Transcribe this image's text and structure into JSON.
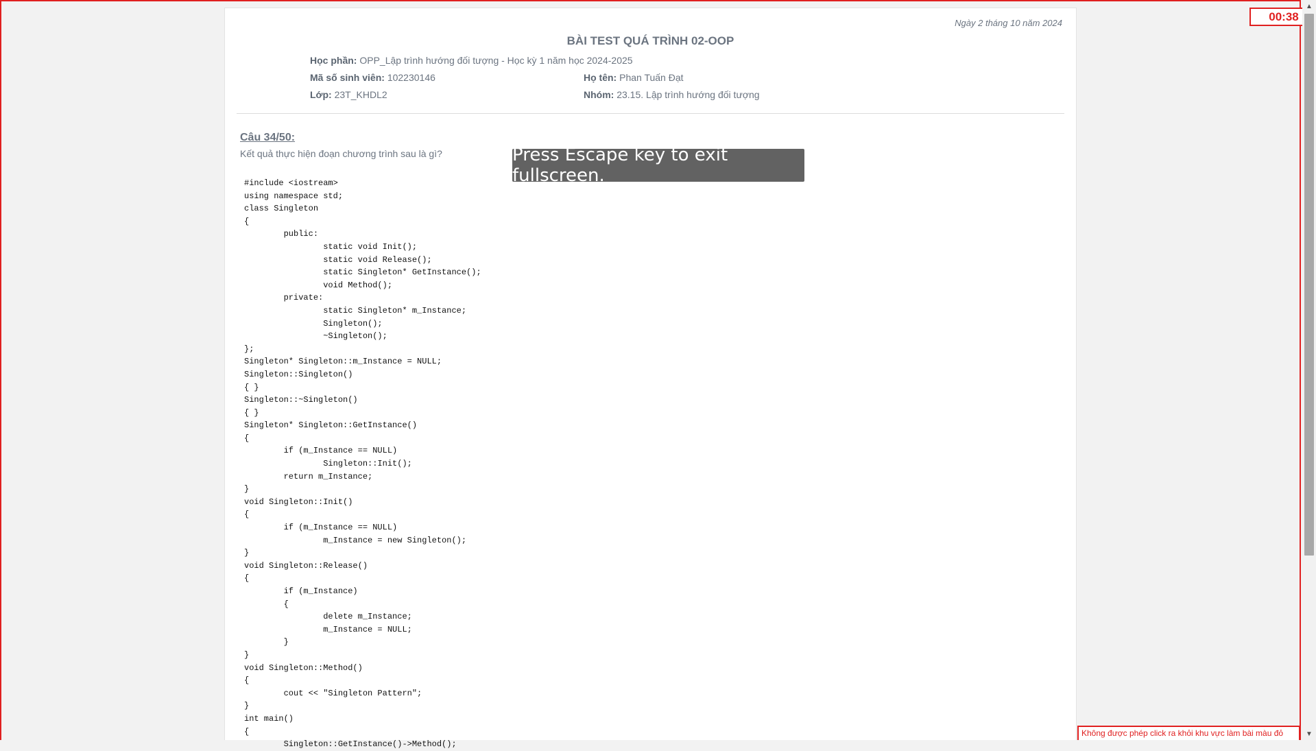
{
  "header": {
    "date": "Ngày 2 tháng 10 năm 2024",
    "title": "BÀI TEST QUÁ TRÌNH 02-OOP",
    "course_label": "Học phần:",
    "course_value": "OPP_Lập trình hướng đối tượng - Học kỳ 1 năm học 2024-2025",
    "student_id_label": "Mã số sinh viên:",
    "student_id_value": "102230146",
    "name_label": "Họ tên:",
    "name_value": "Phan Tuấn Đạt",
    "class_label": "Lớp:",
    "class_value": "23T_KHDL2",
    "group_label": "Nhóm:",
    "group_value": "23.15. Lập trình hướng đối tượng"
  },
  "question": {
    "number": "Câu 34/50:",
    "text": "Kết quả thực hiện đoạn chương trình sau là gì?",
    "code": "#include <iostream>\nusing namespace std;\nclass Singleton\n{\n\tpublic:\n\t\tstatic void Init();\n\t\tstatic void Release();\n\t\tstatic Singleton* GetInstance();\n\t\tvoid Method();\n\tprivate:\n\t\tstatic Singleton* m_Instance;\n\t\tSingleton();\n\t\t~Singleton();\n};\nSingleton* Singleton::m_Instance = NULL;\nSingleton::Singleton()\n{ }\nSingleton::~Singleton()\n{ }\nSingleton* Singleton::GetInstance()\n{\n\tif (m_Instance == NULL)\n\t\tSingleton::Init();\n\treturn m_Instance;\n}\nvoid Singleton::Init()\n{\n\tif (m_Instance == NULL)\n\t\tm_Instance = new Singleton();\n}\nvoid Singleton::Release()\n{\n\tif (m_Instance)\n\t{\n\t\tdelete m_Instance;\n\t\tm_Instance = NULL;\n\t}\n}\nvoid Singleton::Method()\n{\n\tcout << \"Singleton Pattern\";\n}\nint main()\n{\n\tSingleton::GetInstance()->Method();"
  },
  "overlay": {
    "fullscreen_notice": "Press Escape key to exit fullscreen."
  },
  "timer": "00:38",
  "warning": "Không được phép click ra khỏi khu vực làm bài màu đỏ",
  "colors": {
    "accent_red": "#e02020",
    "text_gray": "#6b7480"
  },
  "icons": {
    "scroll_up": "scroll-up-arrow-icon",
    "scroll_down": "scroll-down-arrow-icon"
  }
}
